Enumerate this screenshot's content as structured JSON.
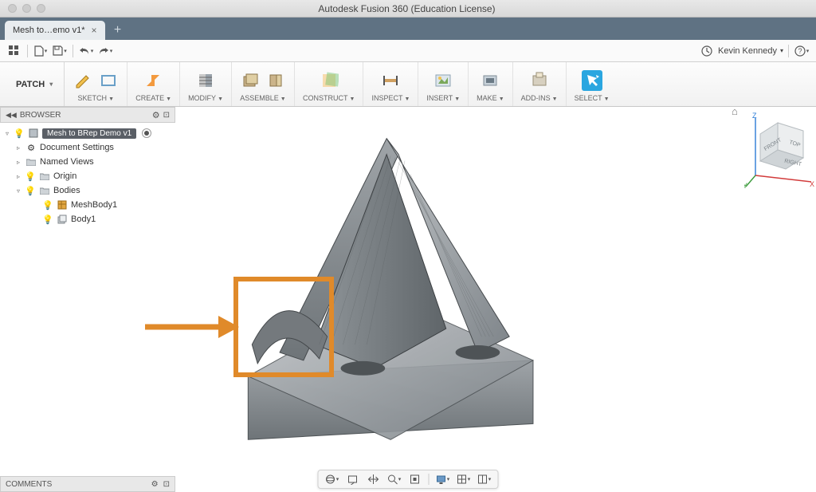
{
  "titlebar": {
    "title": "Autodesk Fusion 360 (Education License)"
  },
  "tab": {
    "name": "Mesh to…emo v1*"
  },
  "quick": {
    "user": "Kevin Kennedy"
  },
  "ribbon": {
    "workspace": "PATCH",
    "groups": [
      {
        "label": "SKETCH",
        "key": "sketch"
      },
      {
        "label": "CREATE",
        "key": "create"
      },
      {
        "label": "MODIFY",
        "key": "modify"
      },
      {
        "label": "ASSEMBLE",
        "key": "assemble"
      },
      {
        "label": "CONSTRUCT",
        "key": "construct"
      },
      {
        "label": "INSPECT",
        "key": "inspect"
      },
      {
        "label": "INSERT",
        "key": "insert"
      },
      {
        "label": "MAKE",
        "key": "make"
      },
      {
        "label": "ADD-INS",
        "key": "addins"
      },
      {
        "label": "SELECT",
        "key": "select"
      }
    ]
  },
  "browser": {
    "header": "BROWSER",
    "root": "Mesh to BRep Demo v1",
    "items": {
      "doc_settings": "Document Settings",
      "named_views": "Named Views",
      "origin": "Origin",
      "bodies": "Bodies",
      "meshbody": "MeshBody1",
      "body1": "Body1"
    }
  },
  "comments": {
    "label": "COMMENTS"
  },
  "viewcube": {
    "top": "TOP",
    "front": "FRONT",
    "right": "RIGHT",
    "axes": {
      "x": "X",
      "y": "Y",
      "z": "Z"
    }
  }
}
